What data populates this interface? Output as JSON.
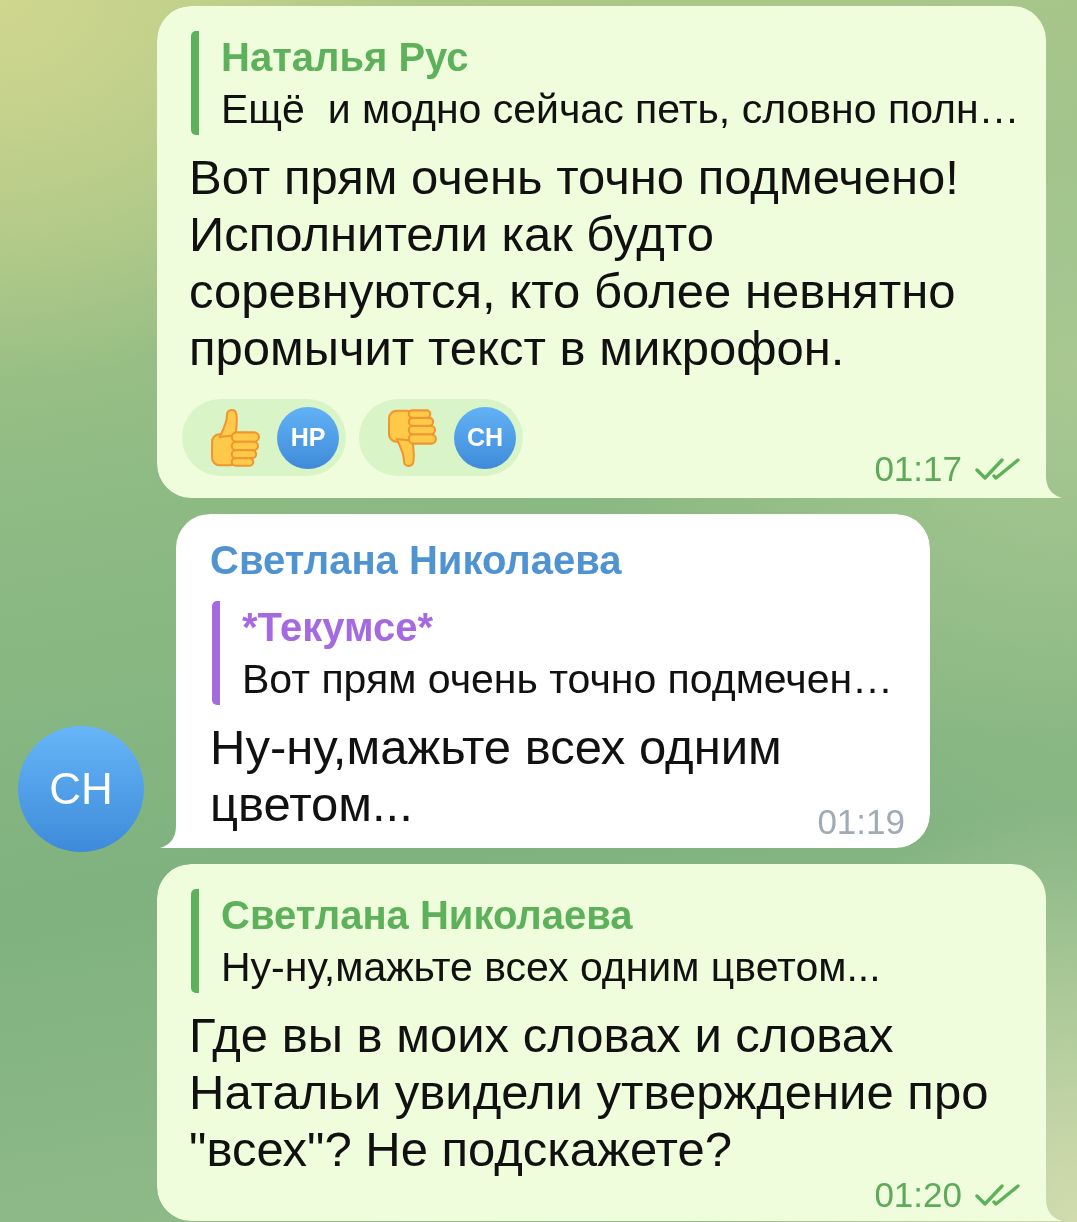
{
  "messages": [
    {
      "kind": "outgoing",
      "reply": {
        "author": "Наталья Рус",
        "text": "Ещё  и модно сейчас петь, словно полн…",
        "color": "#5db15a"
      },
      "text": "Вот прям очень точно подмечено! Исполнители как будто соревнуются, кто более невнятно промычит текст в микрофон.",
      "reactions": [
        {
          "kind": "like",
          "initials": "НР",
          "selected": false
        },
        {
          "kind": "dislike",
          "initials": "СН",
          "selected": false
        }
      ],
      "time": "01:17",
      "read": true
    },
    {
      "kind": "incoming",
      "avatar": "СН",
      "author": {
        "name": "Светлана Николаева",
        "color": "#4f93d0"
      },
      "reply": {
        "author": "*Текумсе*",
        "text": "Вот прям очень точно подмечен…",
        "color": "#a66ae0"
      },
      "text": "Ну-ну,мажьте всех одним цветом...",
      "time": "01:19"
    },
    {
      "kind": "outgoing",
      "reply": {
        "author": "Светлана Николаева",
        "text": "Ну-ну,мажьте всех одним цветом...",
        "color": "#5db15a"
      },
      "text": "Где вы в моих словах и словах Натальи увидели утверждение про \"всех\"? Не подскажете?",
      "time": "01:20",
      "read": true
    }
  ]
}
